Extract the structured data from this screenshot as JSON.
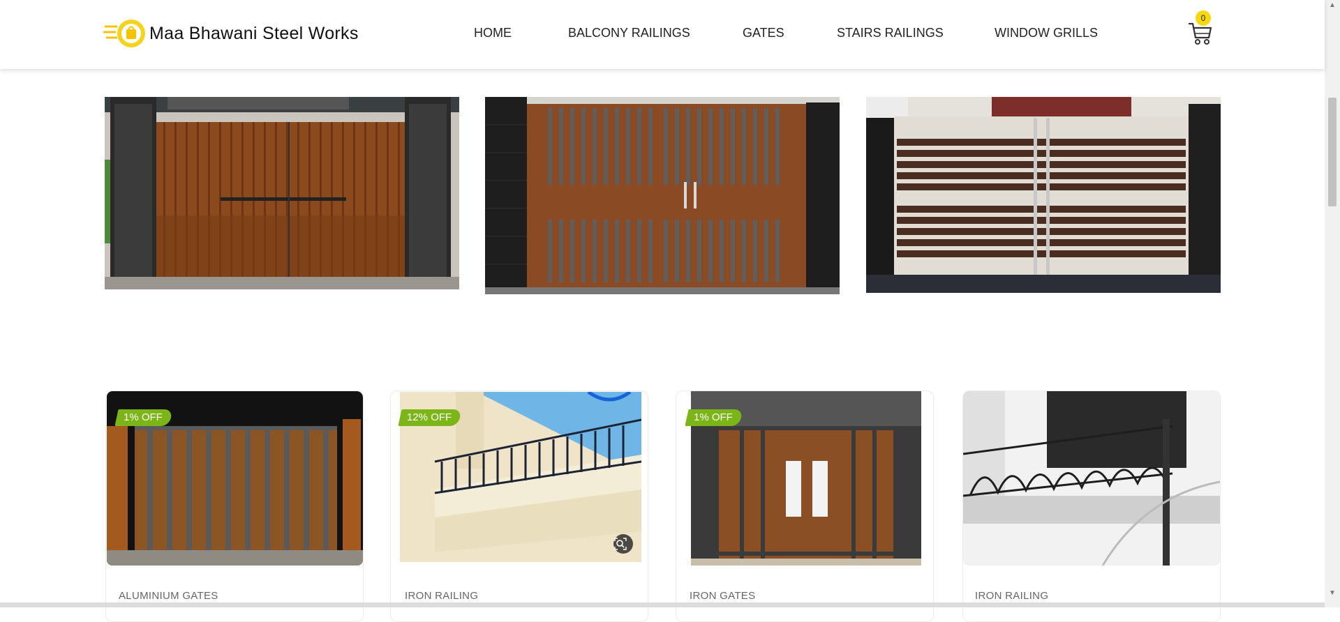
{
  "brand": {
    "name": "Maa Bhawani Steel Works",
    "logo_icon": "fast-delivery-bag-icon",
    "accent": "#f5d90a"
  },
  "nav": {
    "items": [
      {
        "label": "HOME"
      },
      {
        "label": "BALCONY RAILINGS"
      },
      {
        "label": "GATES"
      },
      {
        "label": "STAIRS RAILINGS"
      },
      {
        "label": "WINDOW GRILLS"
      }
    ]
  },
  "cart": {
    "count": "0",
    "icon": "shopping-cart-icon"
  },
  "banners": [
    {
      "alt": "wooden finish steel gate"
    },
    {
      "alt": "wood and grey slat steel gate"
    },
    {
      "alt": "dark horizontal slat steel gate"
    }
  ],
  "products": [
    {
      "discount": "1% OFF",
      "category": "ALUMINIUM GATES"
    },
    {
      "discount": "12% OFF",
      "category": "IRON RAILING"
    },
    {
      "discount": "1% OFF",
      "category": "IRON GATES"
    },
    {
      "discount": "",
      "category": "IRON RAILING"
    }
  ],
  "colors": {
    "discount_badge": "#7cb518",
    "cart_badge": "#f5d90a"
  }
}
